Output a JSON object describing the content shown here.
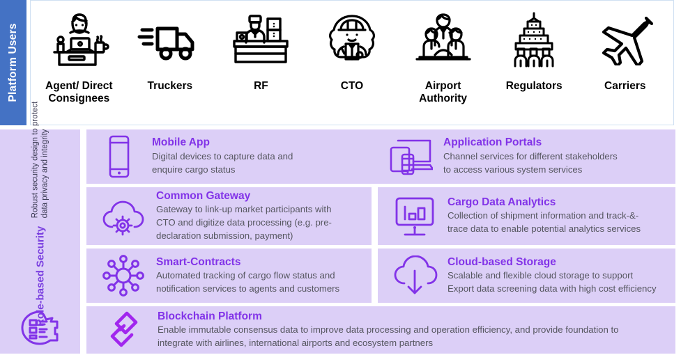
{
  "platform_users": {
    "tab_label": "Platform Users",
    "users": [
      {
        "label": "Agent/ Direct\nConsignees",
        "icon": "agent-desk-icon"
      },
      {
        "label": "Truckers",
        "icon": "truck-icon"
      },
      {
        "label": "RF",
        "icon": "counter-staff-icon"
      },
      {
        "label": "CTO",
        "icon": "worker-helmet-icon"
      },
      {
        "label": "Airport\nAuthority",
        "icon": "people-group-icon"
      },
      {
        "label": "Regulators",
        "icon": "government-building-icon"
      },
      {
        "label": "Carriers",
        "icon": "airplane-icon"
      }
    ]
  },
  "security": {
    "title": "Role-based Security",
    "description": "Robust security design to protect\ndata privacy and integrity",
    "icon": "security-badge-icon"
  },
  "services": [
    {
      "title": "Mobile App",
      "description": "Digital devices to capture data and\nenquire cargo status",
      "icon": "mobile-phone-icon"
    },
    {
      "title": "Application Portals",
      "description": "Channel services for different stakeholders\nto access various system services",
      "icon": "multi-device-icon"
    },
    {
      "title": "Common Gateway",
      "description": "Gateway to link-up market participants with\nCTO and digitize data processing (e.g. pre-\ndeclaration submission, payment)",
      "icon": "cloud-gear-icon"
    },
    {
      "title": "Cargo Data Analytics",
      "description": "Collection of shipment information and track-&-\ntrace data to enable potential analytics services",
      "icon": "monitor-chart-icon"
    },
    {
      "title": "Smart-Contracts",
      "description": "Automated tracking of cargo flow status and\nnotification services to agents and customers",
      "icon": "network-nodes-icon"
    },
    {
      "title": "Cloud-based Storage",
      "description": "Scalable and flexible cloud storage to support\nExport data screening data with high cost efficiency",
      "icon": "cloud-download-icon"
    },
    {
      "title": "Blockchain Platform",
      "description": "Enable immutable consensus data to improve data processing and operation efficiency, and provide foundation to\nintegrate with airlines, international airports and ecosystem partners",
      "icon": "chain-link-icon"
    }
  ],
  "colors": {
    "platform_tab_blue": "#4472C4",
    "card_purple_bg": "#DCCFF7",
    "accent_purple": "#8233E8",
    "title_purple": "#7A3FE0",
    "body_gray": "#55565F"
  }
}
